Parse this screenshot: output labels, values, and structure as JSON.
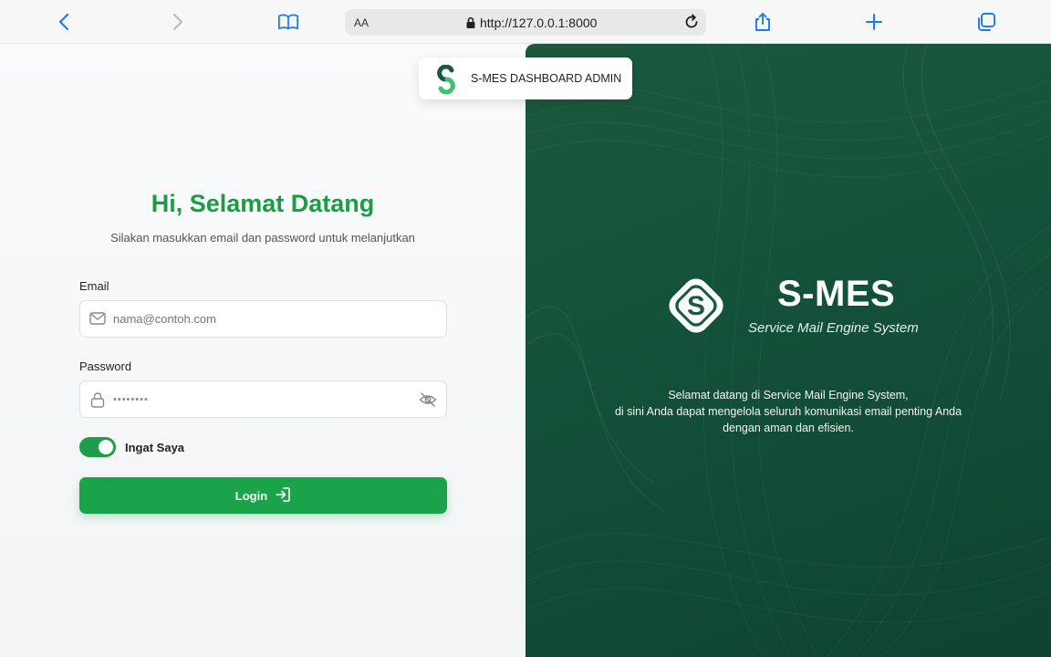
{
  "browser": {
    "address_aa": "AA",
    "url": "http://127.0.0.1:8000"
  },
  "header_badge": {
    "title": "S-MES DASHBOARD ADMIN"
  },
  "login": {
    "heading": "Hi, Selamat Datang",
    "subtitle": "Silakan masukkan email dan password untuk melanjutkan",
    "email_label": "Email",
    "email_placeholder": "nama@contoh.com",
    "password_label": "Password",
    "password_value": "••••••••",
    "remember_label": "Ingat Saya",
    "remember_checked": true,
    "login_button": "Login"
  },
  "brand": {
    "title": "S-MES",
    "subtitle": "Service Mail Engine System",
    "description_line1": "Selamat datang di Service Mail Engine System,",
    "description_line2": "di sini Anda dapat mengelola seluruh komunikasi email penting Anda",
    "description_line3": "dengan aman dan efisien."
  },
  "colors": {
    "accent_green": "#1aa34a",
    "heading_green": "#1b9c47",
    "panel_dark_green": "#14523a"
  },
  "icons": {
    "toolbar": [
      "back-icon",
      "forward-icon",
      "bookmarks-icon",
      "share-icon",
      "new-tab-icon",
      "tabs-icon"
    ],
    "email_field": "mail-icon",
    "password_field": "lock-icon",
    "password_toggle": "eye-off-icon",
    "login_button": "login-arrow-icon"
  }
}
